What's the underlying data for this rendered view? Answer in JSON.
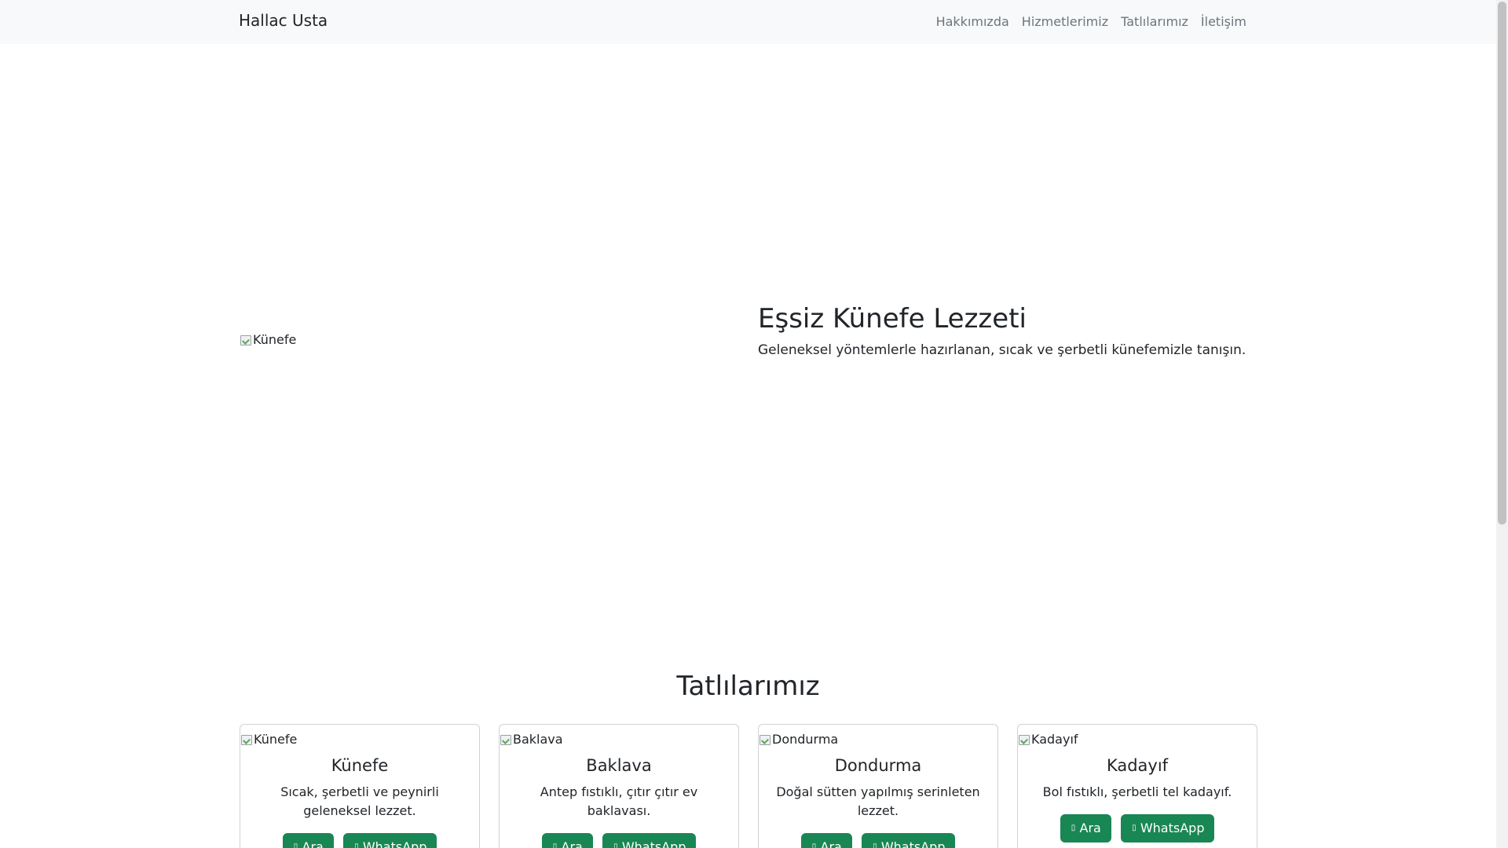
{
  "navbar": {
    "brand": "Hallac Usta",
    "links": [
      "Hakkımızda",
      "Hizmetlerimiz",
      "Tatlılarımız",
      "İletişim"
    ]
  },
  "hero": {
    "image_alt": "Künefe",
    "title": "Eşsiz Künefe Lezzeti",
    "text": "Geleneksel yöntemlerle hazırlanan, sıcak ve şerbetli künefemizle tanışın."
  },
  "section": {
    "title": "Tatlılarımız"
  },
  "cards": [
    {
      "image_alt": "Künefe",
      "title": "Künefe",
      "description": "Sıcak, şerbetli ve peynirli geleneksel lezzet.",
      "call_label": "Ara",
      "whatsapp_label": "WhatsApp"
    },
    {
      "image_alt": "Baklava",
      "title": "Baklava",
      "description": "Antep fıstıklı, çıtır çıtır ev baklavası.",
      "call_label": "Ara",
      "whatsapp_label": "WhatsApp"
    },
    {
      "image_alt": "Dondurma",
      "title": "Dondurma",
      "description": "Doğal sütten yapılmış serinleten lezzet.",
      "call_label": "Ara",
      "whatsapp_label": "WhatsApp"
    },
    {
      "image_alt": "Kadayıf",
      "title": "Kadayıf",
      "description": "Bol fıstıklı, şerbetli tel kadayıf.",
      "call_label": "Ara",
      "whatsapp_label": "WhatsApp"
    }
  ],
  "icons": {
    "call_button": "phone-icon",
    "whatsapp_button": "whatsapp-icon",
    "image_placeholder": "broken-image-icon"
  },
  "colors": {
    "accent": "#198754",
    "navbar_bg": "#f8f9fa",
    "nav_link": "#6c757d"
  }
}
